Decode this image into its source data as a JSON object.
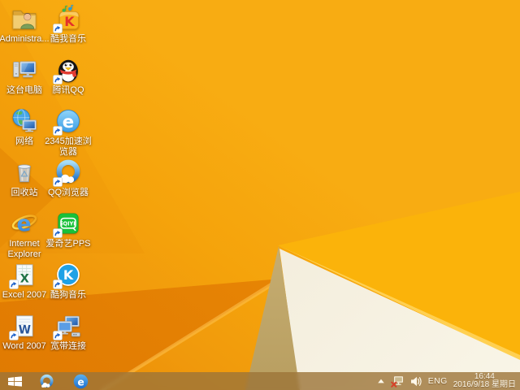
{
  "desktop": {
    "wallpaper_colors": {
      "base_orange": "#f5a30b",
      "dark_orange_facet": "#e07a02",
      "bright_blade": "#fbb30a",
      "cream_facet": "#f3ecd9",
      "tan_facet": "#cdb678"
    },
    "icons": [
      {
        "name": "administrator-folder",
        "label": "Administra...",
        "icon": "user-folder-icon",
        "shortcut": false,
        "col": 0,
        "row": 0,
        "nowrap": true
      },
      {
        "name": "kuwo-music",
        "label": "酷我音乐",
        "icon": "kuwo-music-icon",
        "shortcut": true,
        "col": 1,
        "row": 0
      },
      {
        "name": "this-pc",
        "label": "这台电脑",
        "icon": "computer-icon",
        "shortcut": false,
        "col": 0,
        "row": 1
      },
      {
        "name": "tencent-qq",
        "label": "腾讯QQ",
        "icon": "qq-penguin-icon",
        "shortcut": true,
        "col": 1,
        "row": 1
      },
      {
        "name": "network",
        "label": "网络",
        "icon": "network-globe-icon",
        "shortcut": false,
        "col": 0,
        "row": 2
      },
      {
        "name": "2345-accelerated-browser",
        "label": "2345加速浏览器",
        "icon": "blue-e-browser-icon",
        "shortcut": true,
        "col": 1,
        "row": 2
      },
      {
        "name": "recycle-bin",
        "label": "回收站",
        "icon": "recycle-bin-icon",
        "shortcut": false,
        "col": 0,
        "row": 3
      },
      {
        "name": "qq-browser",
        "label": "QQ浏览器",
        "icon": "qq-browser-icon",
        "shortcut": true,
        "col": 1,
        "row": 3
      },
      {
        "name": "internet-explorer",
        "label": "Internet Explorer",
        "icon": "ie-icon",
        "shortcut": false,
        "col": 0,
        "row": 4
      },
      {
        "name": "iqiyi-pps",
        "label": "爱奇艺PPS",
        "icon": "iqiyi-icon",
        "shortcut": true,
        "col": 1,
        "row": 4
      },
      {
        "name": "excel-2007",
        "label": "Excel 2007",
        "icon": "excel-icon",
        "shortcut": true,
        "col": 0,
        "row": 5
      },
      {
        "name": "kugou-music",
        "label": "酷狗音乐",
        "icon": "kugou-icon",
        "shortcut": true,
        "col": 1,
        "row": 5
      },
      {
        "name": "word-2007",
        "label": "Word 2007",
        "icon": "word-icon",
        "shortcut": true,
        "col": 0,
        "row": 6
      },
      {
        "name": "broadband-connection",
        "label": "宽带连接",
        "icon": "broadband-icon",
        "shortcut": true,
        "col": 1,
        "row": 6
      }
    ]
  },
  "taskbar": {
    "start_button": {
      "icon": "windows-logo-icon"
    },
    "pinned": [
      {
        "name": "taskbar-qq-browser",
        "icon": "qq-browser-icon"
      },
      {
        "name": "taskbar-internet-explorer",
        "icon": "ie-ball-icon"
      }
    ],
    "tray": {
      "chevron_icon": "chevron-up-icon",
      "icons": [
        {
          "name": "network-status",
          "icon": "network-disconnected-icon"
        },
        {
          "name": "volume",
          "icon": "volume-icon"
        }
      ],
      "language": "ENG",
      "clock": {
        "time": "16:44",
        "date": "2016/9/18 星期日"
      }
    }
  }
}
